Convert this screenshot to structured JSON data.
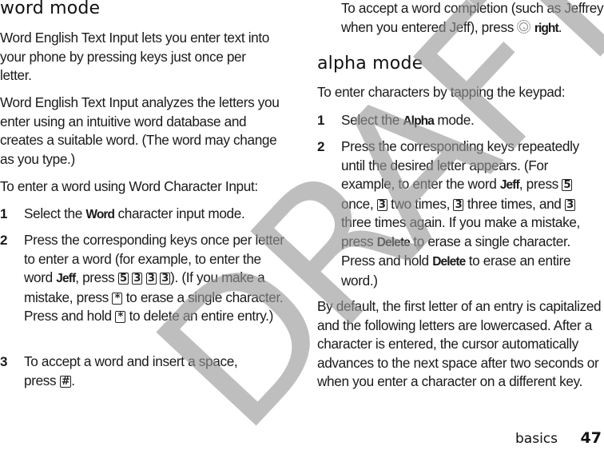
{
  "page": {
    "watermark": "DRAFT",
    "footer": {
      "section": "basics",
      "page_number": "47"
    }
  },
  "left": {
    "heading": "word mode",
    "paragraphs": [
      "Word English Text Input lets you enter text into your phone by pressing keys just once per letter.",
      "Word English Text Input analyzes the letters you enter using an intuitive word database and creates a suitable word. (The word may change as you type.)",
      "To enter a word using Word Character Input:"
    ],
    "steps": [
      {
        "num": "1",
        "pre": "Select the ",
        "bold": "Word",
        "post": " character input mode."
      },
      {
        "num": "2",
        "text_a": "Press the corresponding keys once per letter to enter a word (for example, to enter the word ",
        "bold_a": "Jeff",
        "text_b": ", press ",
        "keys": [
          "5",
          "3",
          "3",
          "3"
        ],
        "text_c": "). (If you make a mistake, press ",
        "key_star": "*",
        "text_d": " to erase a single character. Press and hold ",
        "text_e": " to delete an entire entry.)"
      },
      {
        "num": "3",
        "pre": "To accept a word and insert a space, press ",
        "key": "#",
        "post": "."
      }
    ]
  },
  "right": {
    "continuation": {
      "pre": "To accept a word completion (such as Jeffrey when you entered Jeff), press ",
      "icon": "nav-key-icon",
      "bold": "right",
      "post": "."
    },
    "heading": "alpha mode",
    "intro": "To enter characters by tapping the keypad:",
    "steps": [
      {
        "num": "1",
        "pre": "Select the ",
        "bold": "Alpha",
        "post": " mode."
      },
      {
        "num": "2",
        "text_a": "Press the corresponding keys repeatedly until the desired letter appears. (For example, to enter the word ",
        "bold_a": "Jeff",
        "text_b": ", press ",
        "key_1": "5",
        "text_c": " once, ",
        "key_2": "3",
        "text_d": " two times, ",
        "key_3": "3",
        "text_e": " three times, and ",
        "key_4": "3",
        "text_f": " three times again. If you make a mistake, press ",
        "bold_b": "Delete",
        "text_g": " to erase a single character. Press and hold ",
        "bold_c": "Delete",
        "text_h": " to erase an entire word.)"
      }
    ],
    "closing": "By default, the first letter of an entry is capitalized and the following letters are lowercased. After a character is entered, the cursor automatically advances to the next space after two seconds or when you enter a character on a different key."
  }
}
